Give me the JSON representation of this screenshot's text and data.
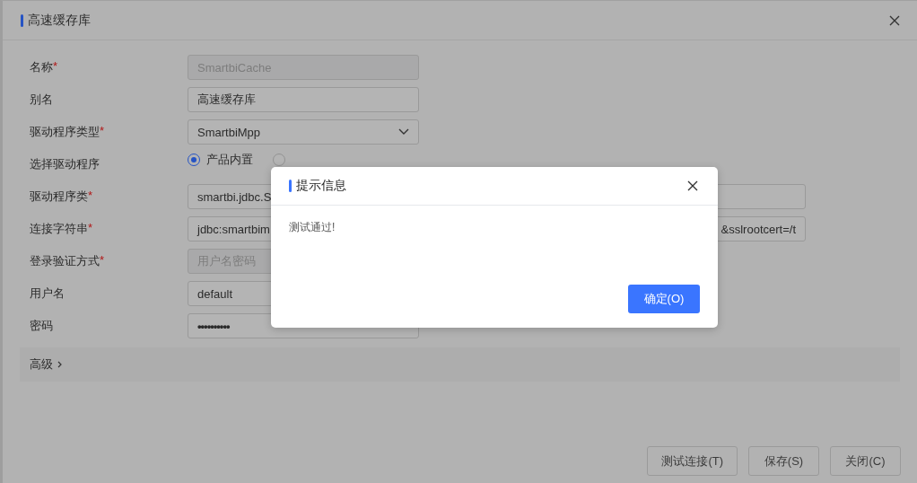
{
  "dialog": {
    "title": "高速缓存库",
    "fields": [
      {
        "label": "名称",
        "required_mark": "*",
        "kind": "text",
        "value": "SmartbiCache",
        "disabled": true
      },
      {
        "label": "别名",
        "kind": "text",
        "value": "高速缓存库",
        "disabled": false
      },
      {
        "label": "驱动程序类型",
        "required_mark": "*",
        "kind": "select",
        "value": "SmartbiMpp",
        "disabled": false
      },
      {
        "label": "选择驱动程序",
        "kind": "radio",
        "options": [
          {
            "label": "产品内置",
            "selected": true
          },
          {
            "selected": false
          }
        ]
      },
      {
        "label": "驱动程序类",
        "required_mark": "*",
        "kind": "wide",
        "value": "smartbi.jdbc.S",
        "disabled": false
      },
      {
        "label": "连接字符串",
        "required_mark": "*",
        "kind": "wide",
        "value": "jdbc:smartbim",
        "value_end": "&sslrootcert=/t",
        "disabled": false
      },
      {
        "label": "登录验证方式",
        "required_mark": "*",
        "kind": "text",
        "value": "用户名密码",
        "disabled": true
      },
      {
        "label": "用户名",
        "kind": "text",
        "value": "default",
        "disabled": false
      },
      {
        "label": "密码",
        "kind": "password",
        "value": "••••••••••",
        "disabled": false
      }
    ],
    "advanced": {
      "label": "高级",
      "expanded": false
    },
    "buttons": [
      "测试连接(T)",
      "保存(S)",
      "关闭(C)"
    ]
  },
  "message_box": {
    "title": "提示信息",
    "message": "测试通过!",
    "button": "确定(O)"
  }
}
